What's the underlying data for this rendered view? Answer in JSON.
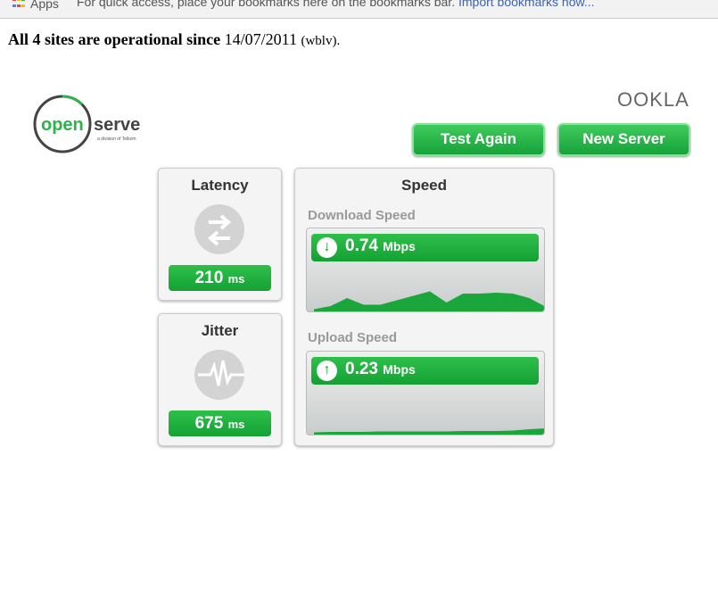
{
  "bookmarks_bar": {
    "apps_label": "Apps",
    "message": "For quick access, place your bookmarks here on the bookmarks bar.",
    "import_link": "Import bookmarks now..."
  },
  "status": {
    "bold": "All 4 sites are operational since",
    "date": "14/07/2011",
    "source": "(wblv)."
  },
  "logo": {
    "word1": "open",
    "word2": "serve",
    "tagline": "a division of Telkom"
  },
  "ookla": "OOKLA",
  "buttons": {
    "test_again": "Test Again",
    "new_server": "New Server"
  },
  "latency": {
    "title": "Latency",
    "value": "210",
    "unit": "ms"
  },
  "jitter": {
    "title": "Jitter",
    "value": "675",
    "unit": "ms"
  },
  "speed": {
    "title": "Speed",
    "download": {
      "label": "Download Speed",
      "value": "0.74",
      "unit": "Mbps",
      "graph": [
        0.05,
        0.12,
        0.3,
        0.15,
        0.15,
        0.25,
        0.35,
        0.45,
        0.2,
        0.4,
        0.4,
        0.42,
        0.4,
        0.3,
        0.1
      ]
    },
    "upload": {
      "label": "Upload Speed",
      "value": "0.23",
      "unit": "Mbps",
      "graph": [
        0.05,
        0.06,
        0.06,
        0.06,
        0.07,
        0.07,
        0.07,
        0.07,
        0.07,
        0.08,
        0.08,
        0.08,
        0.09,
        0.12,
        0.14
      ]
    }
  },
  "colors": {
    "green": "#1aa63a",
    "link": "#3b63b8"
  }
}
